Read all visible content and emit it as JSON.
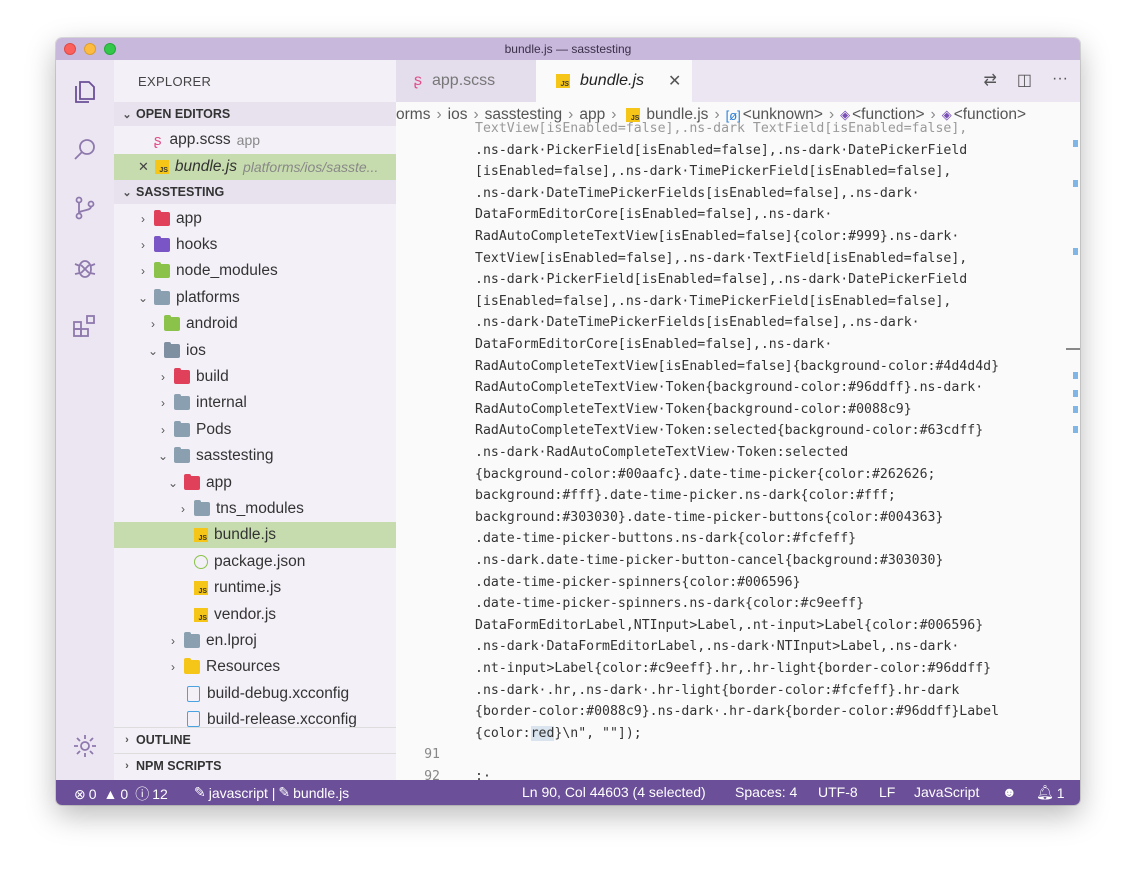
{
  "window": {
    "title": "bundle.js — sasstesting"
  },
  "sidebar": {
    "title": "EXPLORER",
    "open_editors": {
      "header": "OPEN EDITORS",
      "items": [
        {
          "name": "app.scss",
          "detail": "app"
        },
        {
          "name": "bundle.js",
          "detail": "platforms/ios/sasste..."
        }
      ]
    },
    "project": {
      "header": "SASSTESTING",
      "items": [
        "app",
        "hooks",
        "node_modules",
        "platforms",
        "android",
        "ios",
        "build",
        "internal",
        "Pods",
        "sasstesting",
        "app",
        "tns_modules",
        "bundle.js",
        "package.json",
        "runtime.js",
        "vendor.js",
        "en.lproj",
        "Resources",
        "build-debug.xcconfig",
        "build-release.xcconfig"
      ]
    },
    "outline": "OUTLINE",
    "npm_scripts": "NPM SCRIPTS"
  },
  "tabs": [
    {
      "label": "app.scss"
    },
    {
      "label": "bundle.js"
    }
  ],
  "tab_close": "✕",
  "breadcrumb": [
    "orms",
    "ios",
    "sasstesting",
    "app",
    "bundle.js",
    "<unknown>",
    "<function>",
    "<function>"
  ],
  "code": {
    "lines": [
      "TextView[isEnabled=false],.ns-dark TextField[isEnabled=false],",
      ".ns-dark·PickerField[isEnabled=false],.ns-dark·DatePickerField",
      "[isEnabled=false],.ns-dark·TimePickerField[isEnabled=false],",
      ".ns-dark·DateTimePickerFields[isEnabled=false],.ns-dark·",
      "DataFormEditorCore[isEnabled=false],.ns-dark·",
      "RadAutoCompleteTextView[isEnabled=false]{color:#999}.ns-dark·",
      "TextView[isEnabled=false],.ns-dark·TextField[isEnabled=false],",
      ".ns-dark·PickerField[isEnabled=false],.ns-dark·DatePickerField",
      "[isEnabled=false],.ns-dark·TimePickerField[isEnabled=false],",
      ".ns-dark·DateTimePickerFields[isEnabled=false],.ns-dark·",
      "DataFormEditorCore[isEnabled=false],.ns-dark·",
      "RadAutoCompleteTextView[isEnabled=false]{background-color:#4d4d4d}",
      "RadAutoCompleteTextView·Token{background-color:#96ddff}.ns-dark·",
      "RadAutoCompleteTextView·Token{background-color:#0088c9}",
      "RadAutoCompleteTextView·Token:selected{background-color:#63cdff}",
      ".ns-dark·RadAutoCompleteTextView·Token:selected",
      "{background-color:#00aafc}.date-time-picker{color:#262626;",
      "background:#fff}.date-time-picker.ns-dark{color:#fff;",
      "background:#303030}.date-time-picker-buttons{color:#004363}",
      ".date-time-picker-buttons.ns-dark{color:#fcfeff}",
      ".ns-dark.date-time-picker-button-cancel{background:#303030}",
      ".date-time-picker-spinners{color:#006596}",
      ".date-time-picker-spinners.ns-dark{color:#c9eeff}",
      "DataFormEditorLabel,NTInput>Label,.nt-input>Label{color:#006596}",
      ".ns-dark·DataFormEditorLabel,.ns-dark·NTInput>Label,.ns-dark·",
      ".nt-input>Label{color:#c9eeff}.hr,.hr-light{border-color:#96ddff}",
      ".ns-dark·.hr,.ns-dark·.hr-light{border-color:#fcfeff}.hr-dark",
      "{border-color:#0088c9}.ns-dark·.hr-dark{border-color:#96ddff}Label"
    ],
    "last_line_pre": "{color:",
    "last_line_sel": "red",
    "last_line_post": "}\\n\", \"\"]);",
    "line_numbers": [
      "91",
      "92"
    ],
    "line_92": ";·"
  },
  "status": {
    "errors": "0",
    "warnings": "0",
    "info": "12",
    "project": "javascript | ",
    "file": "bundle.js",
    "position": "Ln 90, Col 44603 (4 selected)",
    "spaces": "Spaces: 4",
    "encoding": "UTF-8",
    "eol": "LF",
    "language": "JavaScript",
    "notifications": "1"
  },
  "colors": {
    "accent": "#6b4f98",
    "titlebar": "#c8b8dc",
    "selection": "#c7dcae"
  }
}
